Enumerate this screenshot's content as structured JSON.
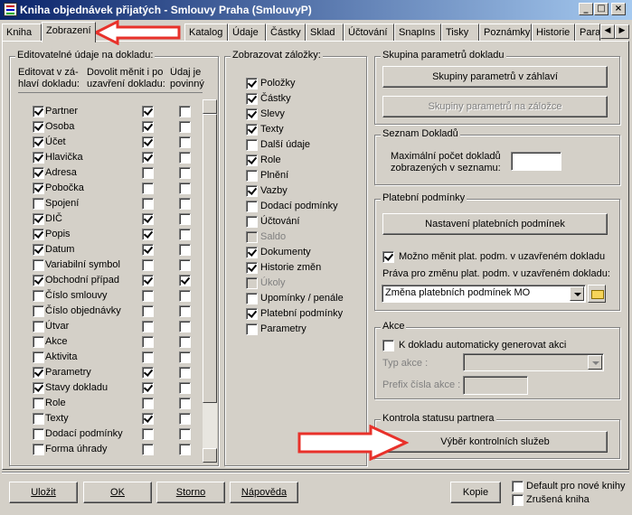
{
  "window": {
    "title": "Kniha objednávek přijatých - Smlouvy Praha (SmlouvyP)",
    "min": "_",
    "max": "□",
    "close": "×"
  },
  "tabs": [
    "Kniha",
    "Zobrazení",
    "Katalog",
    "Údaje",
    "Částky",
    "Sklad",
    "Účtování",
    "SnapIns",
    "Tisky",
    "Poznámky",
    "Historie",
    "Para"
  ],
  "editable": {
    "group_label": "Editovatelné údaje na dokladu:",
    "col1": "Editovat v zá-\nhlaví dokladu:",
    "col2": "Dovolit měnit i po\nuzavření dokladu:",
    "col3": "Údaj je\npovinný",
    "rows": [
      {
        "label": "Partner",
        "c1": true,
        "c2": true,
        "c3": false
      },
      {
        "label": "Osoba",
        "c1": true,
        "c2": true,
        "c3": false
      },
      {
        "label": "Účet",
        "c1": true,
        "c2": true,
        "c3": false
      },
      {
        "label": "Hlavička",
        "c1": true,
        "c2": true,
        "c3": false
      },
      {
        "label": "Adresa",
        "c1": true,
        "c2": false,
        "c3": false
      },
      {
        "label": "Pobočka",
        "c1": true,
        "c2": false,
        "c3": false
      },
      {
        "label": "Spojení",
        "c1": false,
        "c2": false,
        "c3": false
      },
      {
        "label": "DIČ",
        "c1": true,
        "c2": true,
        "c3": false
      },
      {
        "label": "Popis",
        "c1": true,
        "c2": true,
        "c3": false
      },
      {
        "label": "Datum",
        "c1": true,
        "c2": true,
        "c3": false
      },
      {
        "label": "Variabilní symbol",
        "c1": false,
        "c2": false,
        "c3": false
      },
      {
        "label": "Obchodní případ",
        "c1": true,
        "c2": true,
        "c3": true
      },
      {
        "label": "Číslo smlouvy",
        "c1": false,
        "c2": false,
        "c3": false
      },
      {
        "label": "Číslo objednávky",
        "c1": false,
        "c2": false,
        "c3": false
      },
      {
        "label": "Útvar",
        "c1": false,
        "c2": false,
        "c3": false
      },
      {
        "label": "Akce",
        "c1": false,
        "c2": false,
        "c3": false
      },
      {
        "label": "Aktivita",
        "c1": false,
        "c2": false,
        "c3": false
      },
      {
        "label": "Parametry",
        "c1": true,
        "c2": true,
        "c3": false
      },
      {
        "label": "Stavy dokladu",
        "c1": true,
        "c2": true,
        "c3": false
      },
      {
        "label": "Role",
        "c1": false,
        "c2": false,
        "c3": false
      },
      {
        "label": "Texty",
        "c1": false,
        "c2": true,
        "c3": false
      },
      {
        "label": "Dodací podmínky",
        "c1": false,
        "c2": false,
        "c3": false
      },
      {
        "label": "Forma úhrady",
        "c1": false,
        "c2": false,
        "c3": false
      }
    ]
  },
  "tabsToShow": {
    "group_label": "Zobrazovat záložky:",
    "items": [
      {
        "label": "Položky",
        "checked": true,
        "disabled": false
      },
      {
        "label": "Částky",
        "checked": true,
        "disabled": false
      },
      {
        "label": "Slevy",
        "checked": true,
        "disabled": false
      },
      {
        "label": "Texty",
        "checked": true,
        "disabled": false
      },
      {
        "label": "Další údaje",
        "checked": false,
        "disabled": false
      },
      {
        "label": "Role",
        "checked": true,
        "disabled": false
      },
      {
        "label": "Plnění",
        "checked": false,
        "disabled": false
      },
      {
        "label": "Vazby",
        "checked": true,
        "disabled": false
      },
      {
        "label": "Dodací podmínky",
        "checked": false,
        "disabled": false
      },
      {
        "label": "Účtování",
        "checked": false,
        "disabled": false
      },
      {
        "label": "Saldo",
        "checked": false,
        "disabled": true
      },
      {
        "label": "Dokumenty",
        "checked": true,
        "disabled": false
      },
      {
        "label": "Historie změn",
        "checked": true,
        "disabled": false
      },
      {
        "label": "Úkoly",
        "checked": false,
        "disabled": true
      },
      {
        "label": "Upomínky / penále",
        "checked": false,
        "disabled": false
      },
      {
        "label": "Platební podmínky",
        "checked": true,
        "disabled": false
      },
      {
        "label": "Parametry",
        "checked": false,
        "disabled": false
      }
    ]
  },
  "paramGroup": {
    "label": "Skupina parametrů dokladu",
    "btn_header": "Skupiny parametrů v záhlaví",
    "btn_tab": "Skupiny parametrů na záložce"
  },
  "docList": {
    "label": "Seznam Dokladů",
    "max_label": "Maximální počet dokladů\nzobrazených v seznamu:",
    "max_value": ""
  },
  "payment": {
    "label": "Platební podmínky",
    "btn": "Nastavení platebních podmínek",
    "allow_label": "Možno měnit plat. podm. v uzavřeném dokladu",
    "allow_checked": true,
    "rights_label": "Práva pro změnu plat. podm. v uzavřeném dokladu:",
    "rights_value": "Změna platebních podmínek MO"
  },
  "action": {
    "label": "Akce",
    "auto_label": "K dokladu automaticky generovat akci",
    "auto_checked": false,
    "type_label": "Typ akce :",
    "type_value": "",
    "prefix_label": "Prefix čísla akce :",
    "prefix_value": ""
  },
  "partner": {
    "label": "Kontrola statusu partnera",
    "btn": "Výběr kontrolních služeb"
  },
  "footer": {
    "save": "Uložit",
    "ok": "OK",
    "cancel": "Storno",
    "help": "Nápověda",
    "copy": "Kopie",
    "default_label": "Default pro nové knihy",
    "default_checked": false,
    "cancelled_label": "Zrušená kniha",
    "cancelled_checked": false
  },
  "colors": {
    "annotation": "#e8312a",
    "face": "#d4d0c8",
    "title_start": "#0a246a",
    "title_end": "#a6caf0"
  }
}
